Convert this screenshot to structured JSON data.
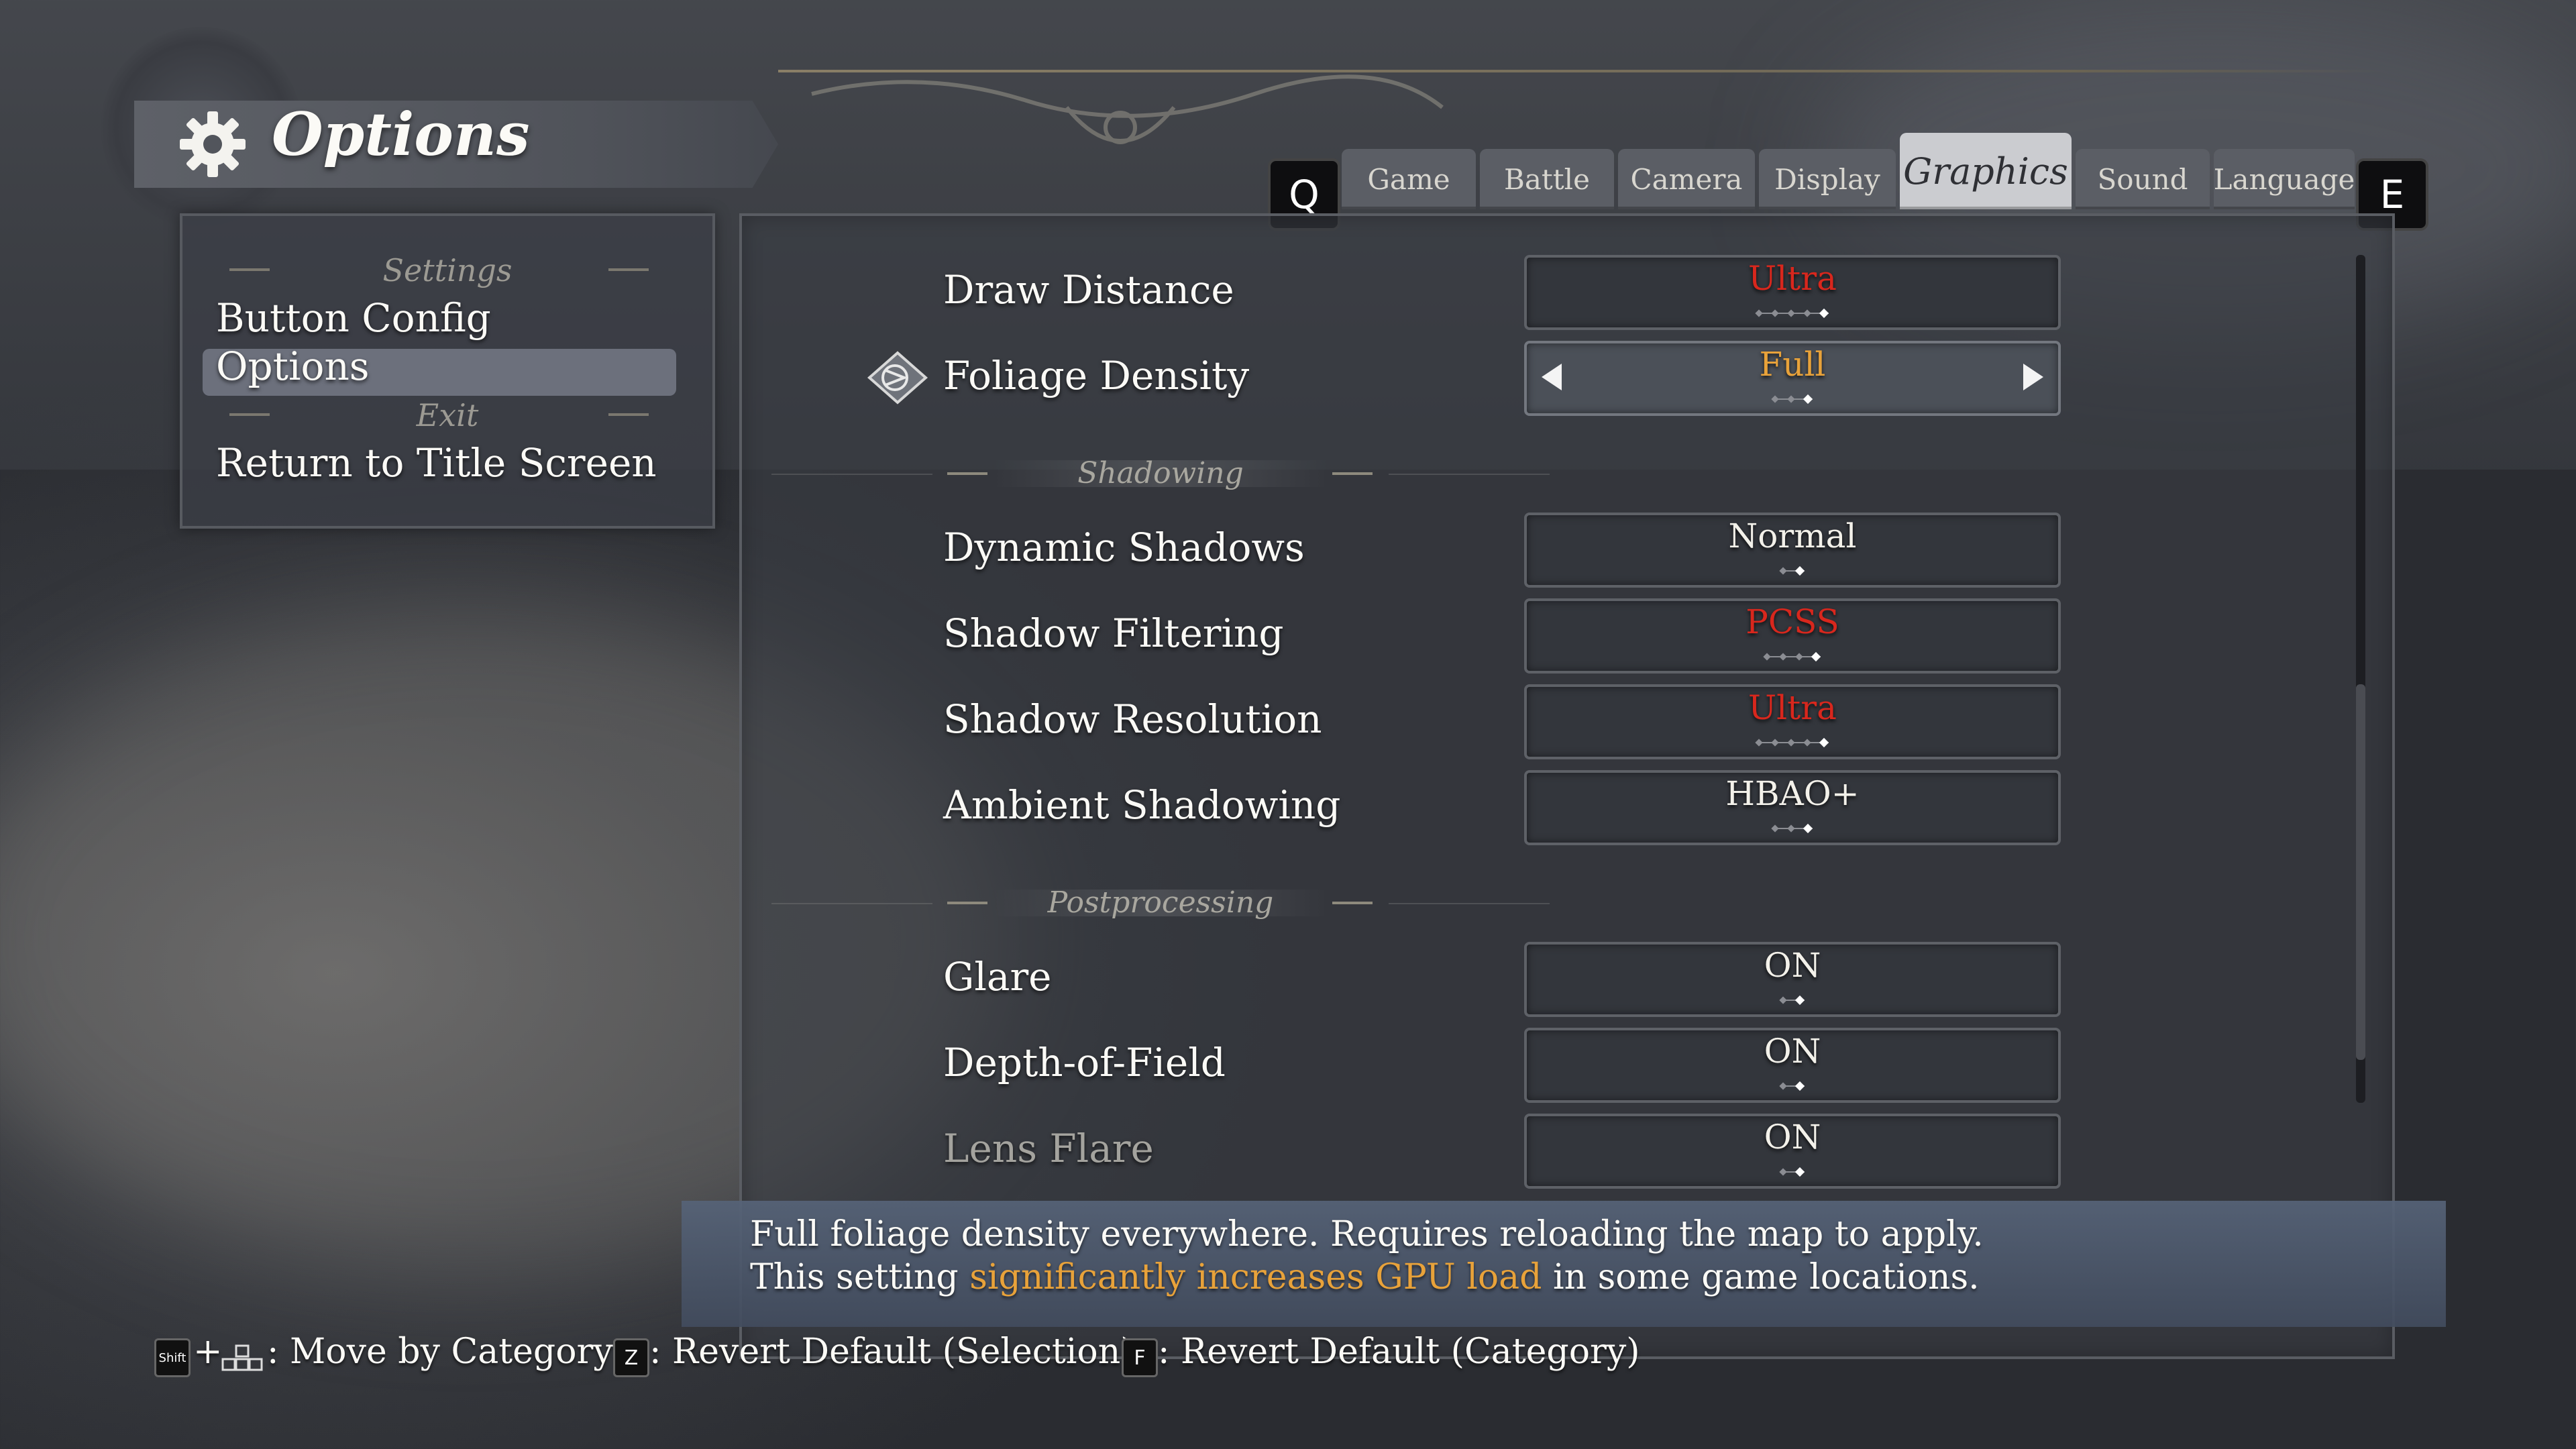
{
  "header": {
    "title": "Options",
    "icons": {
      "title": "gear-icon"
    }
  },
  "left_menu": {
    "sections": [
      {
        "heading": "Settings",
        "items": [
          "Button Config",
          "Options"
        ]
      },
      {
        "heading": "Exit",
        "items": [
          "Return to Title Screen"
        ]
      }
    ],
    "selected": "Options"
  },
  "tabs": {
    "prev_key": "Q",
    "next_key": "E",
    "items": [
      "Game",
      "Battle",
      "Camera",
      "Display",
      "Graphics",
      "Sound",
      "Language"
    ],
    "active": "Graphics"
  },
  "settings": {
    "rows": [
      {
        "label": "Draw Distance",
        "value": "Ultra",
        "value_color": "#d8271d",
        "level": 5,
        "levels": 5
      },
      {
        "label": "Foliage Density",
        "value": "Full",
        "value_color": "#e8a23a",
        "level": 3,
        "levels": 3,
        "selected": true
      },
      {
        "label": "Dynamic Shadows",
        "value": "Normal",
        "value_color": "#f3f1ea",
        "level": 2,
        "levels": 2
      },
      {
        "label": "Shadow Filtering",
        "value": "PCSS",
        "value_color": "#d8271d",
        "level": 4,
        "levels": 4
      },
      {
        "label": "Shadow Resolution",
        "value": "Ultra",
        "value_color": "#d8271d",
        "level": 5,
        "levels": 5
      },
      {
        "label": "Ambient Shadowing",
        "value": "HBAO+",
        "value_color": "#f3f1ea",
        "level": 3,
        "levels": 3
      },
      {
        "label": "Glare",
        "value": "ON",
        "value_color": "#f3f1ea",
        "level": 2,
        "levels": 2
      },
      {
        "label": "Depth-of-Field",
        "value": "ON",
        "value_color": "#f3f1ea",
        "level": 2,
        "levels": 2
      },
      {
        "label": "Lens Flare",
        "value": "ON",
        "value_color": "#f3f1ea",
        "level": 2,
        "levels": 2
      }
    ],
    "subheadings": {
      "shadowing": "Shadowing",
      "postprocessing": "Postprocessing"
    }
  },
  "description": {
    "line1": "Full foliage density everywhere. Requires reloading the map to apply.",
    "line2_pre": "This setting ",
    "line2_highlight": "significantly increases GPU load",
    "line2_post": " in some game locations.",
    "highlight_color": "#e8a23a"
  },
  "footer": {
    "hints": [
      {
        "keys": [
          "Shift",
          "+"
        ],
        "text": ": Move by Category"
      },
      {
        "keys": [
          "Z"
        ],
        "text": ": Revert Default (Selection)"
      },
      {
        "keys": [
          "F"
        ],
        "text": ": Revert Default (Category)"
      }
    ]
  }
}
